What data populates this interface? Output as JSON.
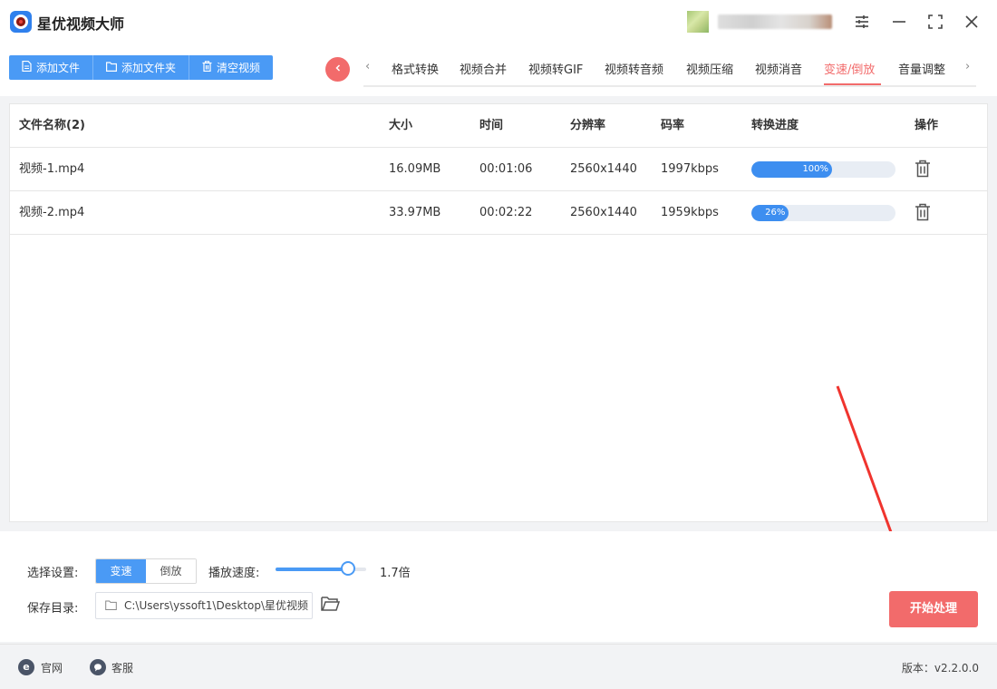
{
  "app": {
    "title": "星优视频大师"
  },
  "window": {
    "settings_icon": "sliders-icon",
    "minimize_icon": "minimize-icon",
    "maximize_icon": "maximize-icon",
    "close_icon": "close-icon"
  },
  "toolbar": {
    "add_file": "添加文件",
    "add_folder": "添加文件夹",
    "clear_videos": "清空视频"
  },
  "tabs": [
    {
      "label": "格式转换",
      "active": false
    },
    {
      "label": "视频合并",
      "active": false
    },
    {
      "label": "视频转GIF",
      "active": false
    },
    {
      "label": "视频转音频",
      "active": false
    },
    {
      "label": "视频压缩",
      "active": false
    },
    {
      "label": "视频消音",
      "active": false
    },
    {
      "label": "变速/倒放",
      "active": true
    },
    {
      "label": "音量调整",
      "active": false
    }
  ],
  "table": {
    "headers": {
      "name": "文件名称(2)",
      "size": "大小",
      "time": "时间",
      "resolution": "分辨率",
      "bitrate": "码率",
      "progress": "转换进度",
      "action": "操作"
    },
    "rows": [
      {
        "name": "视频-1.mp4",
        "size": "16.09MB",
        "time": "00:01:06",
        "resolution": "2560x1440",
        "bitrate": "1997kbps",
        "progress": 0.56,
        "progress_label": "100%"
      },
      {
        "name": "视频-2.mp4",
        "size": "33.97MB",
        "time": "00:02:22",
        "resolution": "2560x1440",
        "bitrate": "1959kbps",
        "progress": 0.26,
        "progress_label": "26%"
      }
    ]
  },
  "settings": {
    "mode_label": "选择设置:",
    "mode_speed": "变速",
    "mode_reverse": "倒放",
    "speed_label": "播放速度:",
    "speed_value": "1.7倍",
    "speed_slider_level": 0.8,
    "save_label": "保存目录:",
    "save_path": "C:\\Users\\yssoft1\\Desktop\\星优视频",
    "start_button": "开始处理"
  },
  "footer": {
    "website": "官网",
    "support": "客服",
    "version": "版本：v2.2.0.0"
  },
  "colors": {
    "accent_blue": "#4a9af5",
    "accent_red": "#f26b6b"
  }
}
